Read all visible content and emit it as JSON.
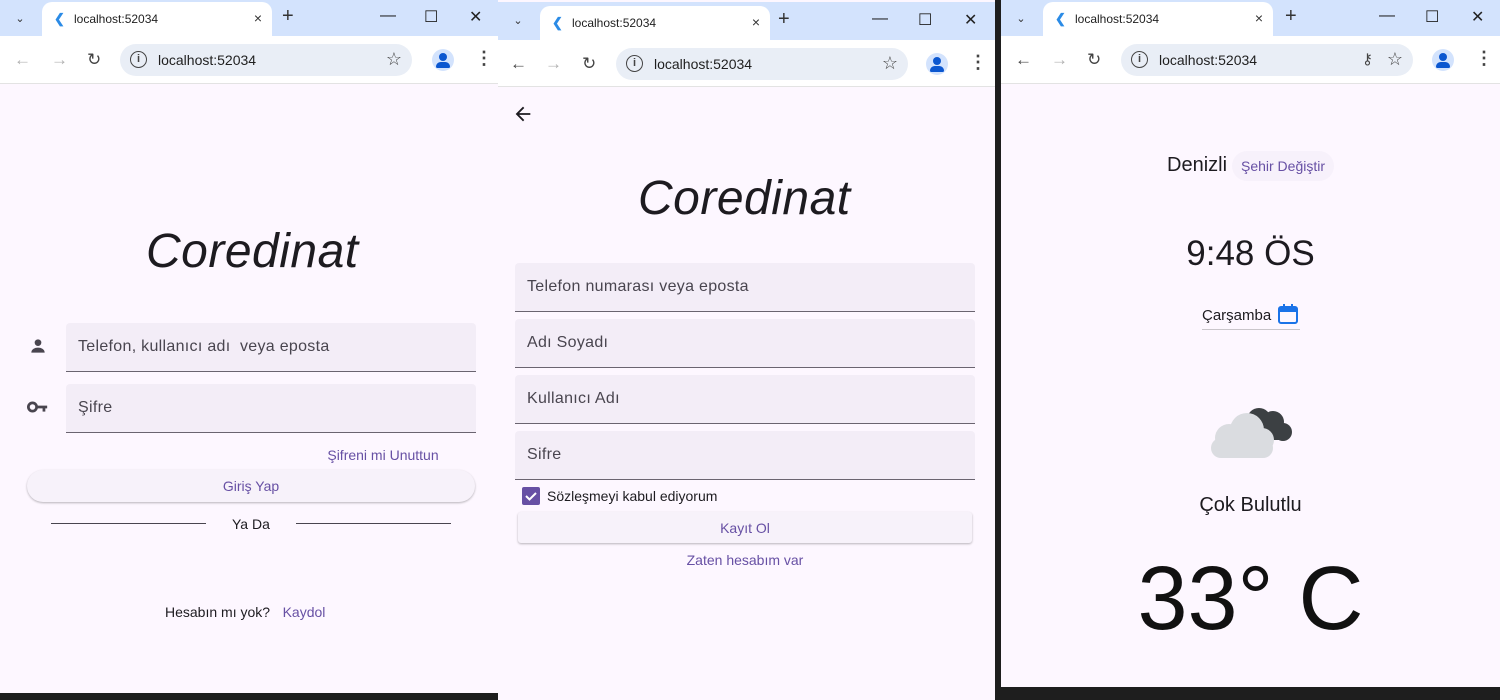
{
  "browser": {
    "tab_title": "localhost:52034",
    "url": "localhost:52034",
    "new_tab": "+",
    "close_tab": "×",
    "minimize": "—",
    "maximize": "☐",
    "close_window": "✕"
  },
  "login": {
    "brand": "Coredinat",
    "user_placeholder": "Telefon, kullanıcı adı  veya eposta",
    "password_placeholder": "Şifre",
    "forgot_password": "Şifreni mi Unuttun",
    "login_button": "Giriş Yap",
    "or_text": "Ya Da",
    "no_account": "Hesabın mı yok?",
    "signup_link": "Kaydol"
  },
  "register": {
    "brand": "Coredinat",
    "phone_email_placeholder": "Telefon numarası veya eposta",
    "fullname_placeholder": "Adı Soyadı",
    "username_placeholder": "Kullanıcı Adı",
    "password_placeholder": "Sifre",
    "agreement_label": "Sözleşmeyi kabul ediyorum",
    "agreement_checked": true,
    "register_button": "Kayıt Ol",
    "have_account": "Zaten hesabım var"
  },
  "weather": {
    "city": "Denizli",
    "change_city": "Şehir Değiştir",
    "time": "9:48 ÖS",
    "day": "Çarşamba",
    "condition": "Çok Bulutlu",
    "temperature": "33° C",
    "condition_icon": "cloudy-icon"
  },
  "colors": {
    "page_bg": "#fdf7ff",
    "primary": "#6750a4",
    "field_bg": "#f3edf7",
    "tab_strip": "#d3e3fd"
  }
}
